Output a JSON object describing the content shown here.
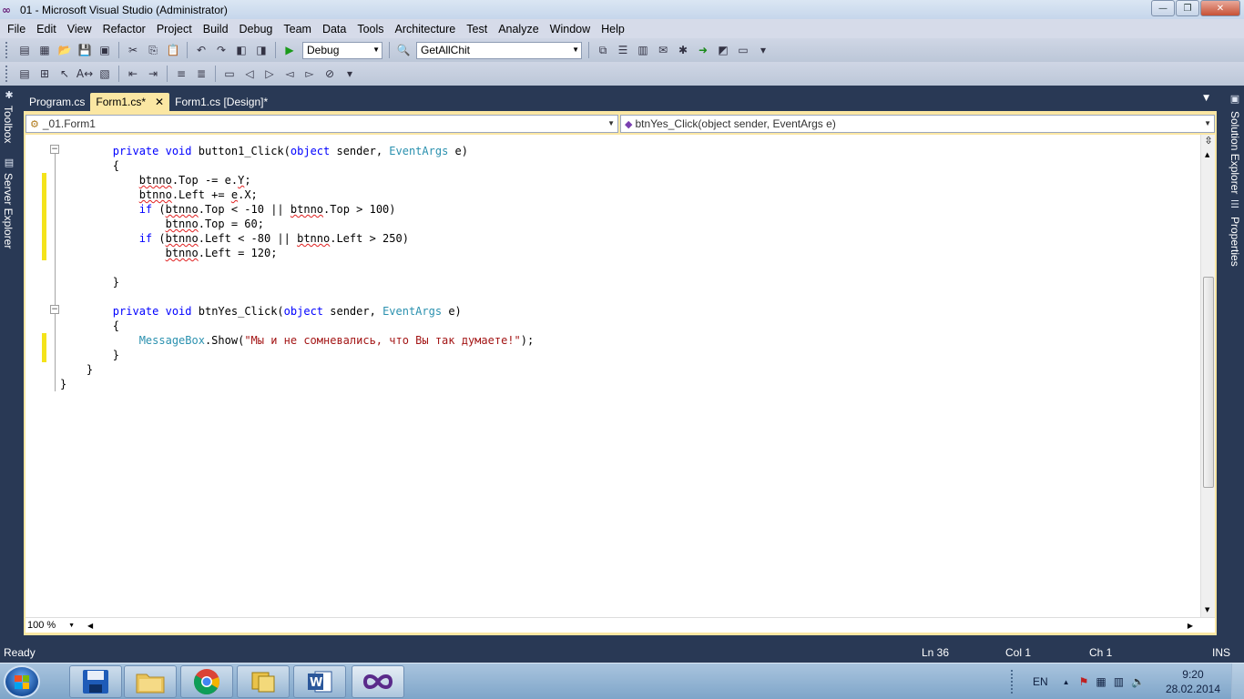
{
  "window": {
    "title": "01 - Microsoft Visual Studio (Administrator)",
    "buttons": {
      "minimize": "—",
      "maximize": "❐",
      "close": "✕"
    }
  },
  "menu": [
    "File",
    "Edit",
    "View",
    "Refactor",
    "Project",
    "Build",
    "Debug",
    "Team",
    "Data",
    "Tools",
    "Architecture",
    "Test",
    "Analyze",
    "Window",
    "Help"
  ],
  "toolbar": {
    "configuration": "Debug",
    "find_combo": "GetAllChit"
  },
  "side_tabs": {
    "left": [
      "Toolbox",
      "Server Explorer"
    ],
    "right": [
      "Solution Explorer",
      "Properties"
    ]
  },
  "doc_tabs": [
    {
      "label": "Program.cs",
      "active": false
    },
    {
      "label": "Form1.cs*",
      "active": true,
      "close": "✕"
    },
    {
      "label": "Form1.cs [Design]*",
      "active": false
    }
  ],
  "nav": {
    "class": "_01.Form1",
    "member": "btnYes_Click(object sender, EventArgs e)"
  },
  "editor": {
    "zoom": "100 %"
  },
  "status": {
    "message": "Ready",
    "line": "Ln 36",
    "col": "Col 1",
    "ch": "Ch 1",
    "mode": "INS"
  },
  "taskbar": {
    "apps": [
      "save-app",
      "file-explorer",
      "chrome",
      "app-4",
      "word",
      "visual-studio"
    ],
    "language": "EN",
    "time": "9:20",
    "date": "28.02.2014"
  },
  "colors": {
    "accent": "#293955",
    "tab_active": "#fbe7a3",
    "keyword": "#0000ff",
    "type": "#2b91af",
    "string": "#a31515"
  }
}
